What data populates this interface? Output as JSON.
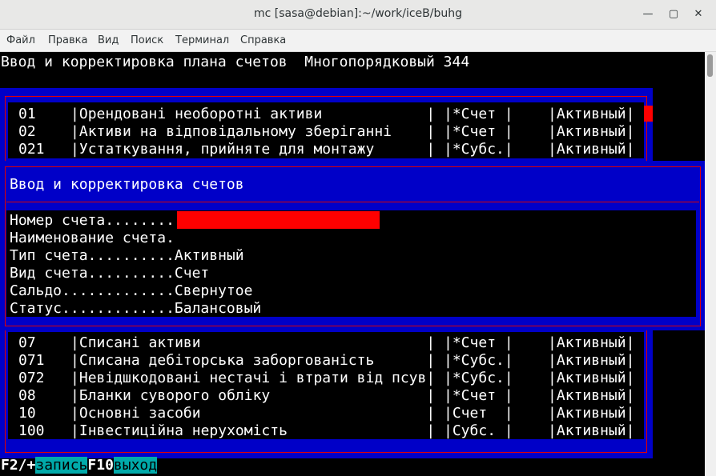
{
  "window": {
    "title": "mc [sasa@debian]:~/work/iceB/buhg",
    "minimize_icon": "minimize-icon",
    "maximize_icon": "maximize-icon",
    "close_icon": "close-icon"
  },
  "menu": [
    "Файл",
    "Правка",
    "Вид",
    "Поиск",
    "Терминал",
    "Справка"
  ],
  "header": "Ввод и корректировка плана счетов  Многопорядковый 344",
  "accounts_top": [
    "01    |Орендовані необоротні активи            | |*Счет |    |Активный|",
    "02    |Активи на відповідальному зберіганні    | |*Счет |    |Активный|",
    "021   |Устаткування, прийняте для монтажу      | |*Субс.|    |Активный|"
  ],
  "dialog": {
    "title": "Ввод и корректировка счетов",
    "fields": [
      "Номер счета........",
      "Наименование счета.",
      "Тип счета..........Активный",
      "Вид счета..........Счет",
      "Сальдо.............Свернутое",
      "Статус.............Балансовый"
    ]
  },
  "accounts_bottom": [
    "07    |Списані активи                          | |*Счет |    |Активный|",
    "071   |Списана дебіторська заборгованість      | |*Субс.|    |Активный|",
    "072   |Невідшкодовані нестачі і втрати від псув| |*Субс.|    |Активный|",
    "08    |Бланки суворого обліку                  | |*Счет |    |Активный|",
    "10    |Основні засоби                          | |Счет  |    |Активный|",
    "100   |Інвестиційна нерухомість                | |Субс. |    |Активный|"
  ],
  "keys": {
    "f2": "F2/+",
    "f2_label": "запись",
    "f10": "F10",
    "f10_label": "выход"
  },
  "colors": {
    "panel_blue": "#0000c8",
    "frame_red": "#e00000",
    "cursor_red": "#ff0000",
    "key_cyan": "#00aaaa"
  }
}
